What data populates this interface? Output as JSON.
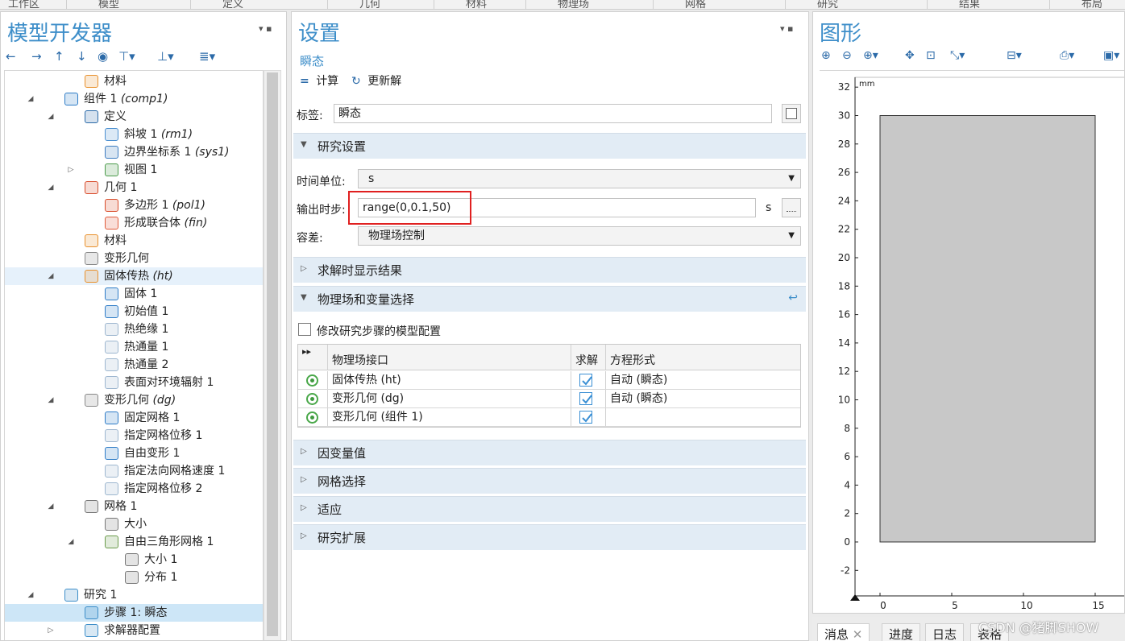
{
  "ribbon": [
    "工作区",
    "模型",
    "定义",
    "几何",
    "材料",
    "物理场",
    "网格",
    "研究",
    "结果",
    "布局"
  ],
  "model": {
    "title": "模型开发器",
    "ctl": "▾ ▪",
    "toolbar": [
      "←",
      "→",
      "↑",
      "↓",
      "◉",
      "⊤▾",
      "⊥▾",
      "≣▾"
    ],
    "tree": [
      {
        "label": "材料",
        "italic": "",
        "indent": 3,
        "exp": "",
        "icon": "materials-icon",
        "color": "#e8902c",
        "sel": ""
      },
      {
        "label": "组件 1",
        "italic": "(comp1)",
        "indent": 2,
        "exp": "◢",
        "icon": "component-icon",
        "color": "#2e7cc7",
        "sel": ""
      },
      {
        "label": "定义",
        "italic": "",
        "indent": 3,
        "exp": "◢",
        "icon": "definitions-icon",
        "color": "#2b6aa8",
        "sel": ""
      },
      {
        "label": "斜坡 1",
        "italic": "(rm1)",
        "indent": 4,
        "exp": "",
        "icon": "ramp-icon",
        "color": "#4a8fd0",
        "sel": ""
      },
      {
        "label": "边界坐标系 1",
        "italic": "(sys1)",
        "indent": 4,
        "exp": "",
        "icon": "coordinate-system-icon",
        "color": "#3c7cc0",
        "sel": ""
      },
      {
        "label": "视图 1",
        "italic": "",
        "indent": 4,
        "exp": "▷",
        "icon": "view-icon",
        "color": "#4a9a4a",
        "sel": ""
      },
      {
        "label": "几何 1",
        "italic": "",
        "indent": 3,
        "exp": "◢",
        "icon": "geometry-icon",
        "color": "#d84b2a",
        "sel": ""
      },
      {
        "label": "多边形 1",
        "italic": "(pol1)",
        "indent": 4,
        "exp": "",
        "icon": "polygon-icon",
        "color": "#d84b2a",
        "sel": ""
      },
      {
        "label": "形成联合体",
        "italic": "(fin)",
        "indent": 4,
        "exp": "",
        "icon": "form-union-icon",
        "color": "#e05a3a",
        "sel": ""
      },
      {
        "label": "材料",
        "italic": "",
        "indent": 3,
        "exp": "",
        "icon": "materials-icon",
        "color": "#e8902c",
        "sel": ""
      },
      {
        "label": "变形几何",
        "italic": "",
        "indent": 3,
        "exp": "",
        "icon": "deformed-geometry-icon",
        "color": "#888888",
        "sel": ""
      },
      {
        "label": "固体传热",
        "italic": "(ht)",
        "indent": 3,
        "exp": "◢",
        "icon": "heat-transfer-icon",
        "color": "#e8902c",
        "sel": "h"
      },
      {
        "label": "固体 1",
        "italic": "",
        "indent": 4,
        "exp": "",
        "icon": "solid-icon",
        "color": "#2e7cc7",
        "sel": ""
      },
      {
        "label": "初始值 1",
        "italic": "",
        "indent": 4,
        "exp": "",
        "icon": "initial-values-icon",
        "color": "#2e7cc7",
        "sel": ""
      },
      {
        "label": "热绝缘 1",
        "italic": "",
        "indent": 4,
        "exp": "",
        "icon": "thermal-insulation-icon",
        "color": "#9db6cf",
        "sel": ""
      },
      {
        "label": "热通量 1",
        "italic": "",
        "indent": 4,
        "exp": "",
        "icon": "heat-flux-icon",
        "color": "#9db6cf",
        "sel": ""
      },
      {
        "label": "热通量 2",
        "italic": "",
        "indent": 4,
        "exp": "",
        "icon": "heat-flux-icon",
        "color": "#9db6cf",
        "sel": ""
      },
      {
        "label": "表面对环境辐射 1",
        "italic": "",
        "indent": 4,
        "exp": "",
        "icon": "surface-radiation-icon",
        "color": "#9db6cf",
        "sel": ""
      },
      {
        "label": "变形几何",
        "italic": "(dg)",
        "indent": 3,
        "exp": "◢",
        "icon": "deformed-geometry-icon",
        "color": "#888888",
        "sel": ""
      },
      {
        "label": "固定网格 1",
        "italic": "",
        "indent": 4,
        "exp": "",
        "icon": "fixed-mesh-icon",
        "color": "#2e7cc7",
        "sel": ""
      },
      {
        "label": "指定网格位移 1",
        "italic": "",
        "indent": 4,
        "exp": "",
        "icon": "prescribed-displacement-icon",
        "color": "#9db6cf",
        "sel": ""
      },
      {
        "label": "自由变形 1",
        "italic": "",
        "indent": 4,
        "exp": "",
        "icon": "free-deformation-icon",
        "color": "#2e7cc7",
        "sel": ""
      },
      {
        "label": "指定法向网格速度 1",
        "italic": "",
        "indent": 4,
        "exp": "",
        "icon": "normal-velocity-icon",
        "color": "#9db6cf",
        "sel": ""
      },
      {
        "label": "指定网格位移 2",
        "italic": "",
        "indent": 4,
        "exp": "",
        "icon": "prescribed-displacement-icon",
        "color": "#9db6cf",
        "sel": ""
      },
      {
        "label": "网格 1",
        "italic": "",
        "indent": 3,
        "exp": "◢",
        "icon": "mesh-icon",
        "color": "#777777",
        "sel": ""
      },
      {
        "label": "大小",
        "italic": "",
        "indent": 4,
        "exp": "",
        "icon": "size-icon",
        "color": "#777777",
        "sel": ""
      },
      {
        "label": "自由三角形网格 1",
        "italic": "",
        "indent": 4,
        "exp": "◢",
        "icon": "free-triangular-icon",
        "color": "#6a9a4a",
        "sel": ""
      },
      {
        "label": "大小 1",
        "italic": "",
        "indent": 5,
        "exp": "",
        "icon": "size-icon",
        "color": "#777777",
        "sel": ""
      },
      {
        "label": "分布 1",
        "italic": "",
        "indent": 5,
        "exp": "",
        "icon": "distribution-icon",
        "color": "#777777",
        "sel": ""
      },
      {
        "label": "研究 1",
        "italic": "",
        "indent": 2,
        "exp": "◢",
        "icon": "study-icon",
        "color": "#3d8ec9",
        "sel": ""
      },
      {
        "label": "步骤 1: 瞬态",
        "italic": "",
        "indent": 3,
        "exp": "",
        "icon": "time-dependent-icon",
        "color": "#3d8ec9",
        "sel": "s"
      },
      {
        "label": "求解器配置",
        "italic": "",
        "indent": 3,
        "exp": "▷",
        "icon": "solver-config-icon",
        "color": "#3d8ec9",
        "sel": ""
      }
    ]
  },
  "settings": {
    "title": "设置",
    "subtitle": "瞬态",
    "ctl": "▾ ▪",
    "compute": "计算",
    "update": "更新解",
    "label_caption": "标签:",
    "label_value": "瞬态",
    "sections": {
      "study": "研究设置",
      "results": "求解时显示结果",
      "physics": "物理场和变量选择",
      "dep": "因变量值",
      "mesh": "网格选择",
      "adapt": "适应",
      "ext": "研究扩展"
    },
    "time_unit_label": "时间单位:",
    "time_unit_value": "s",
    "output_times_label": "输出时步:",
    "output_times_value": "range(0,0.1,50)",
    "output_unit": "s",
    "tolerance_label": "容差:",
    "tolerance_value": "物理场控制",
    "modify_config": "修改研究步骤的模型配置",
    "table": {
      "headers": [
        "▸▸",
        "物理场接口",
        "求解",
        "方程形式"
      ],
      "rows": [
        {
          "iface": "固体传热 (ht)",
          "form": "自动 (瞬态)"
        },
        {
          "iface": "变形几何 (dg)",
          "form": "自动 (瞬态)"
        },
        {
          "iface": "变形几何 (组件 1)",
          "form": ""
        }
      ]
    },
    "highlight_color": "#e02020"
  },
  "graphics": {
    "title": "图形",
    "toolbar": [
      "⊕",
      "⊖",
      "⊕▾",
      "✥",
      "⊡",
      "⤡▾",
      "⊟▾",
      "⎙▾",
      "▣▾"
    ],
    "unit": "mm",
    "y_ticks": [
      32,
      30,
      28,
      26,
      24,
      22,
      20,
      18,
      16,
      14,
      12,
      10,
      8,
      6,
      4,
      2,
      0,
      -2
    ],
    "x_ticks": [
      0,
      5,
      10,
      15
    ],
    "rect": {
      "x0": 0,
      "x1": 15,
      "y0": 0,
      "y1": 30
    },
    "rect_color": "#c8c8c8"
  },
  "bottom_tabs": [
    "消息",
    "进度",
    "日志",
    "表格"
  ],
  "watermark": "CSDN @猪脚SHOW"
}
